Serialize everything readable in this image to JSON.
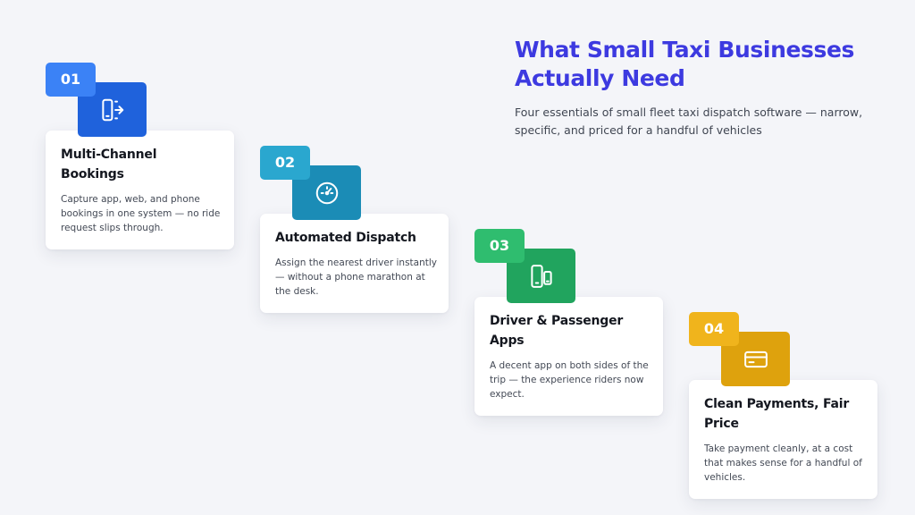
{
  "header": {
    "title_line1": "What Small Taxi Businesses",
    "title_line2": "Actually Need",
    "subtitle": "Four essentials of small fleet taxi dispatch software — narrow, specific, and priced for a handful of vehicles"
  },
  "steps": [
    {
      "number": "01",
      "title": "Multi-Channel Bookings",
      "description": "Capture app, web, and phone bookings in one system — no ride request slips through.",
      "icon": "device-transfer-icon",
      "badge_color": "#3b82f6",
      "icon_color": "#1f62dc"
    },
    {
      "number": "02",
      "title": "Automated Dispatch",
      "description": "Assign the nearest driver instantly — without a phone marathon at the desk.",
      "icon": "gauge-icon",
      "badge_color": "#2aa7cf",
      "icon_color": "#1b8cb6"
    },
    {
      "number": "03",
      "title": "Driver & Passenger Apps",
      "description": "A decent app on both sides of the trip — the experience riders now expect.",
      "icon": "two-phones-icon",
      "badge_color": "#2fbd6f",
      "icon_color": "#21a45e"
    },
    {
      "number": "04",
      "title": "Clean Payments, Fair Price",
      "description": "Take payment cleanly, at a cost that makes sense for a handful of vehicles.",
      "icon": "credit-card-icon",
      "badge_color": "#f0b41c",
      "icon_color": "#dea20d"
    }
  ]
}
